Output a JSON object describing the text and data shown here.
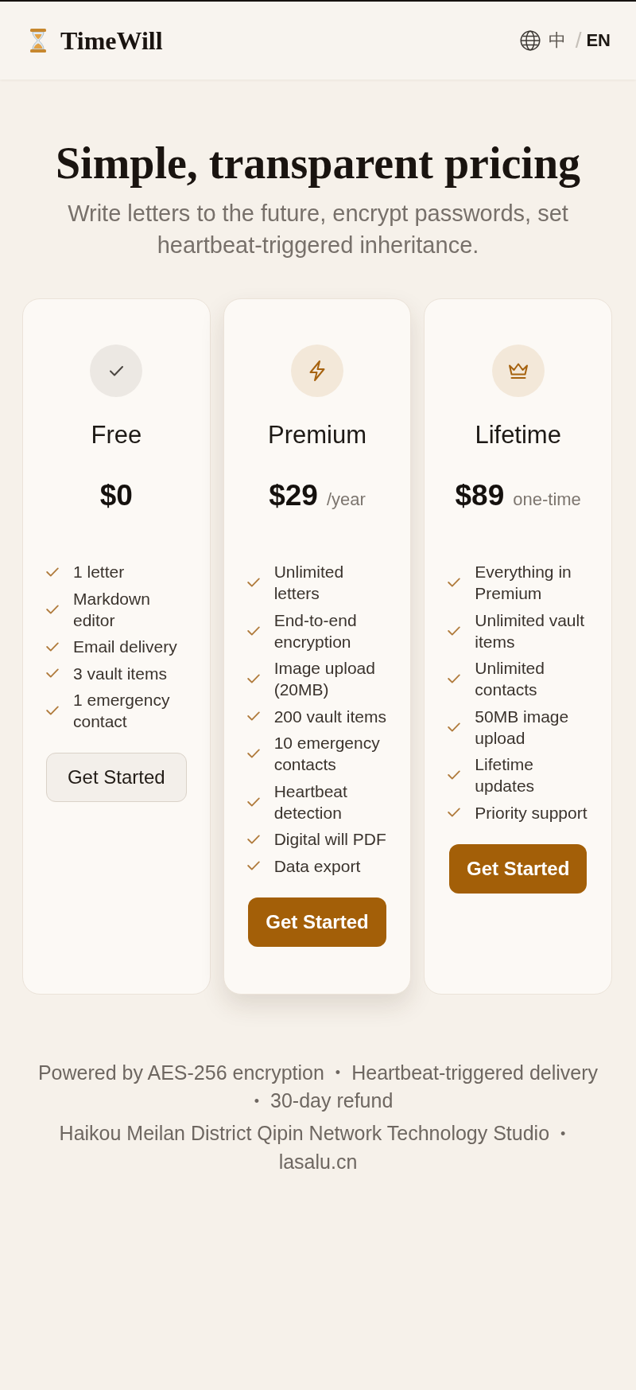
{
  "header": {
    "logo_text": "TimeWill",
    "languages": [
      {
        "label": "中",
        "selected": false
      },
      {
        "label": "EN",
        "selected": true
      }
    ],
    "language_separator": "/"
  },
  "hero": {
    "title": "Simple, transparent pricing",
    "subtitle": "Write letters to the future, encrypt passwords, set heartbeat-triggered inheritance."
  },
  "plans": [
    {
      "kind": "free",
      "name": "Free",
      "price": "$0",
      "featured": false,
      "features": [
        "1 letter",
        "Markdown editor",
        "Email delivery",
        "3 vault items",
        "1 emergency contact"
      ],
      "button": {
        "label": "Get Started",
        "primary": false
      }
    },
    {
      "kind": "premium",
      "name": "Premium",
      "price": "$29",
      "period": "/year",
      "featured": true,
      "features": [
        "Unlimited letters",
        "End-to-end encryption",
        "Image upload (20MB)",
        "200 vault items",
        "10 emergency contacts",
        "Heartbeat detection",
        "Digital will PDF",
        "Data export"
      ],
      "button": {
        "label": "Get Started",
        "primary": true
      }
    },
    {
      "kind": "lifetime",
      "name": "Lifetime",
      "price": "$89",
      "period": "one-time",
      "featured": false,
      "features": [
        "Everything in Premium",
        "Unlimited vault items",
        "Unlimited contacts",
        "50MB image upload",
        "Lifetime updates",
        "Priority support"
      ],
      "button": {
        "label": "Get Started",
        "primary": true
      }
    }
  ],
  "footer": {
    "separator": "•",
    "lines": [
      {
        "items": [
          "Powered by AES-256 encryption",
          "Heartbeat-triggered delivery",
          "30-day refund"
        ]
      },
      {
        "items": [
          "Haikou Meilan District Qipin Network Technology Studio",
          "lasalu.cn"
        ]
      }
    ]
  }
}
